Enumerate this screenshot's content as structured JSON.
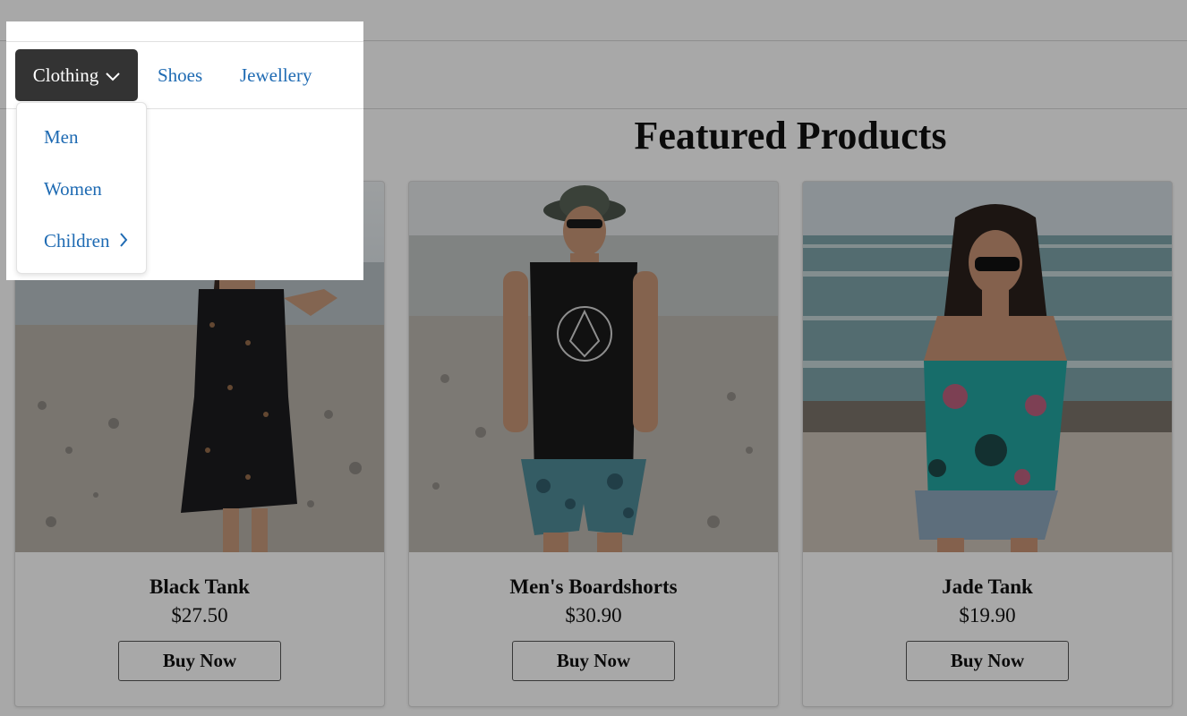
{
  "nav": {
    "dropdown_label": "Clothing",
    "links": [
      "Shoes",
      "Jewellery"
    ],
    "menu_items": [
      "Men",
      "Women",
      "Children"
    ]
  },
  "main": {
    "title": "Featured Products",
    "products": [
      {
        "name": "Black Tank",
        "price": "$27.50",
        "button": "Buy Now"
      },
      {
        "name": "Men's Boardshorts",
        "price": "$30.90",
        "button": "Buy Now"
      },
      {
        "name": "Jade Tank",
        "price": "$19.90",
        "button": "Buy Now"
      }
    ]
  },
  "icons": {
    "toggle": "chevron-down-icon",
    "submenu": "chevron-right-icon"
  },
  "colors": {
    "link": "#1f6bb3",
    "active_toggle": "#333333",
    "overlay": "rgba(0,0,0,0.34)"
  }
}
